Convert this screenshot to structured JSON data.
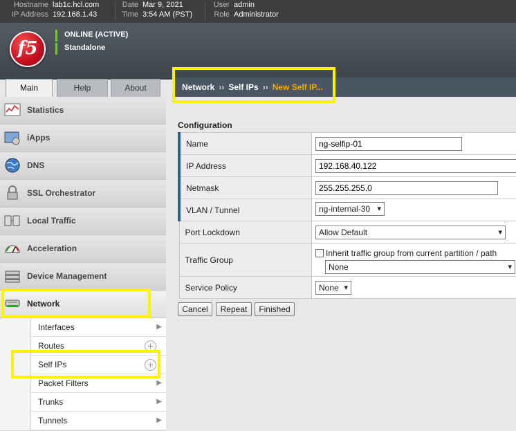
{
  "topbar": {
    "hostname_label": "Hostname",
    "hostname": "lab1c.hcl.com",
    "ip_label": "IP Address",
    "ip": "192.168.1.43",
    "date_label": "Date",
    "date": "Mar 9, 2021",
    "time_label": "Time",
    "time": "3:54 AM (PST)",
    "user_label": "User",
    "user": "admin",
    "role_label": "Role",
    "role": "Administrator"
  },
  "header": {
    "logo_text": "f5",
    "status_online": "ONLINE (ACTIVE)",
    "status_mode": "Standalone",
    "status_color": "#7cc242"
  },
  "tabs": [
    "Main",
    "Help",
    "About"
  ],
  "breadcrumb": {
    "items": [
      "Network",
      "Self IPs"
    ],
    "current": "New Self IP...",
    "separator": "››"
  },
  "nav": {
    "items": [
      {
        "label": "Statistics",
        "icon": "statistics-icon"
      },
      {
        "label": "iApps",
        "icon": "iapps-icon"
      },
      {
        "label": "DNS",
        "icon": "dns-globe-icon"
      },
      {
        "label": "SSL Orchestrator",
        "icon": "ssl-lock-icon"
      },
      {
        "label": "Local Traffic",
        "icon": "local-traffic-icon"
      },
      {
        "label": "Acceleration",
        "icon": "acceleration-gauge-icon"
      },
      {
        "label": "Device Management",
        "icon": "device-management-icon"
      },
      {
        "label": "Network",
        "icon": "network-icon"
      }
    ],
    "sub_items": [
      "Interfaces",
      "Routes",
      "Self IPs",
      "Packet Filters",
      "Trunks",
      "Tunnels"
    ]
  },
  "form": {
    "section_title": "Configuration",
    "name_label": "Name",
    "name_value": "ng-selfip-01",
    "ip_label": "IP Address",
    "ip_value": "192.168.40.122",
    "netmask_label": "Netmask",
    "netmask_value": "255.255.255.0",
    "vlan_label": "VLAN / Tunnel",
    "vlan_value": "ng-internal-30",
    "port_lockdown_label": "Port Lockdown",
    "port_lockdown_value": "Allow Default",
    "traffic_group_label": "Traffic Group",
    "traffic_group_checkbox": "Inherit traffic group from current partition / path",
    "traffic_group_value": "None",
    "service_policy_label": "Service Policy",
    "service_policy_value": "None"
  },
  "buttons": {
    "cancel": "Cancel",
    "repeat": "Repeat",
    "finished": "Finished"
  },
  "colors": {
    "highlight": "#fff200",
    "breadcrumb_current": "#f2a900",
    "required_marker": "#2f5f96"
  }
}
